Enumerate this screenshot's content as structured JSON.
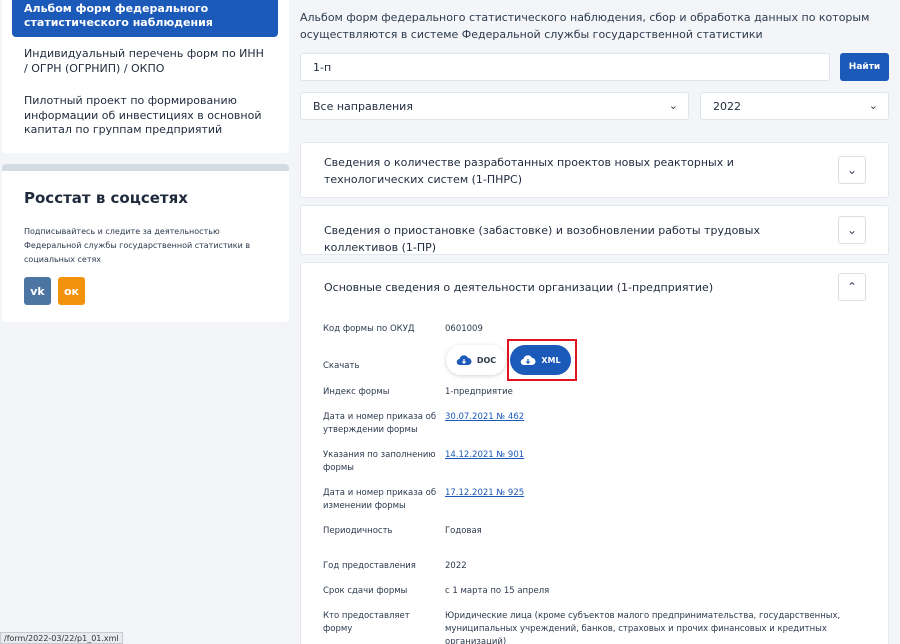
{
  "sidebar": {
    "active_item": "Альбом форм федерального статистического наблюдения",
    "items": [
      "Индивидуальный перечень форм по ИНН / ОГРН (ОГРНИП) / ОКПО",
      "Пилотный проект по формированию информации об инвестициях в основной капитал по группам предприятий"
    ],
    "social": {
      "title": "Росстат в соцсетях",
      "description": "Подписывайтесь и следите за деятельностью Федеральной службы государственной статистики в социальных сетях",
      "vk_label": "vk",
      "ok_label": "ок"
    }
  },
  "main": {
    "header": "Альбом форм федерального статистического наблюдения, сбор и обработка данных по которым осуществляются в системе Федеральной службы государственной статистики",
    "search": {
      "value": "1-п",
      "button": "Найти"
    },
    "filters": {
      "direction": "Все направления",
      "year": "2022"
    },
    "forms": [
      {
        "title": "Сведения о количестве разработанных проектов новых реакторных и технологических систем (1-ПНРС)",
        "expanded": false
      },
      {
        "title": "Сведения о приостановке (забастовке) и возобновлении работы трудовых коллективов (1-ПР)",
        "expanded": false
      },
      {
        "title": "Основные сведения о деятельности организации (1-предприятие)",
        "expanded": true
      }
    ],
    "details": {
      "okud_label": "Код формы по ОКУД",
      "okud_value": "0601009",
      "download_label": "Скачать",
      "doc_label": "DOC",
      "xml_label": "XML",
      "index_label": "Индекс формы",
      "index_value": "1-предприятие",
      "approval_label": "Дата и номер приказа об утверждении формы",
      "approval_value": "30.07.2021 № 462",
      "instructions_label": "Указания по заполнению формы",
      "instructions_value": "14.12.2021 № 901",
      "change_label": "Дата и номер приказа об изменении формы",
      "change_value": "17.12.2021 № 925",
      "period_label": "Периодичность",
      "period_value": "Годовая",
      "year_label": "Год предоставления",
      "year_value": "2022",
      "deadline_label": "Срок сдачи формы",
      "deadline_value": "с 1 марта по 15 апреля",
      "who_label": "Кто предоставляет форму",
      "who_value": "Юридические лица (кроме субъектов малого предпринимательства, государственных, муниципальных учреждений, банков, страховых и прочих финансовых и кредитных организаций)"
    }
  },
  "status_bar": {
    "url": "/form/2022-03/22/p1_01.xml"
  },
  "colors": {
    "primary": "#1c5ab9",
    "highlight": "#e0141e",
    "ok": "#f2920c",
    "vk": "#4c75a3"
  },
  "icons": [
    "chevron-down-icon",
    "chevron-up-icon",
    "cloud-download-icon",
    "vk-icon",
    "odnoklassniki-icon"
  ]
}
